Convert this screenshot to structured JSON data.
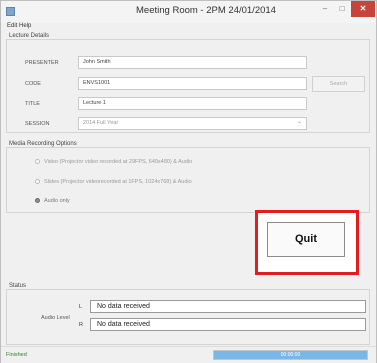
{
  "window": {
    "title": "Meeting Room - 2PM 24/01/2014",
    "minimize_glyph": "–",
    "maximize_glyph": "□",
    "close_glyph": "✕"
  },
  "menu": {
    "label": "Edit Help"
  },
  "lecture_details": {
    "group_label": "Lecture Details",
    "presenter": {
      "label": "PRESENTER",
      "value": "John Smith"
    },
    "code": {
      "label": "CODE",
      "value": "ENVS1001"
    },
    "search_button": "Search",
    "title": {
      "label": "TITLE",
      "value": "Lecture 1"
    },
    "session": {
      "label": "SESSION",
      "value": "2014 Full Year"
    }
  },
  "media_options": {
    "group_label": "Media Recording Options",
    "options": [
      {
        "label": "Video (Projector video recorded at 29FPS, 640x480) & Audio",
        "selected": false
      },
      {
        "label": "Slides (Projector videorecorded at 1FPS, 1024x768) & Audio",
        "selected": false
      },
      {
        "label": "Audio only",
        "selected": true
      }
    ]
  },
  "quit_button": "Quit",
  "status": {
    "group_label": "Status",
    "audio_level_label": "Audio Level",
    "channels": [
      {
        "channel": "L",
        "text": "No data received"
      },
      {
        "channel": "R",
        "text": "No data received"
      }
    ]
  },
  "statusbar": {
    "text": "Finished",
    "progress_text": "00:00:00",
    "progress_fraction": 1.0
  },
  "colors": {
    "highlight": "#e21d22",
    "progress": "#79b7e6",
    "close": "#c7443a"
  }
}
